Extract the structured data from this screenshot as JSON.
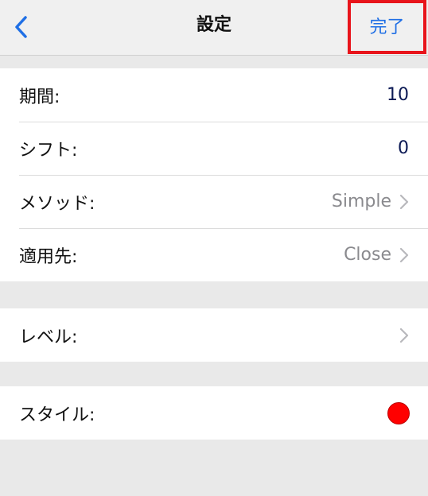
{
  "navbar": {
    "title": "設定",
    "done_label": "完了"
  },
  "settings": {
    "period": {
      "label": "期間:",
      "value": "10"
    },
    "shift": {
      "label": "シフト:",
      "value": "0"
    },
    "method": {
      "label": "メソッド:",
      "value": "Simple"
    },
    "apply_to": {
      "label": "適用先:",
      "value": "Close"
    },
    "level": {
      "label": "レベル:"
    },
    "style": {
      "label": "スタイル:",
      "color": "#ff0000"
    }
  },
  "colors": {
    "accent": "#1f6fe5",
    "highlight_border": "#e8141b",
    "background": "#e9e9e9"
  }
}
